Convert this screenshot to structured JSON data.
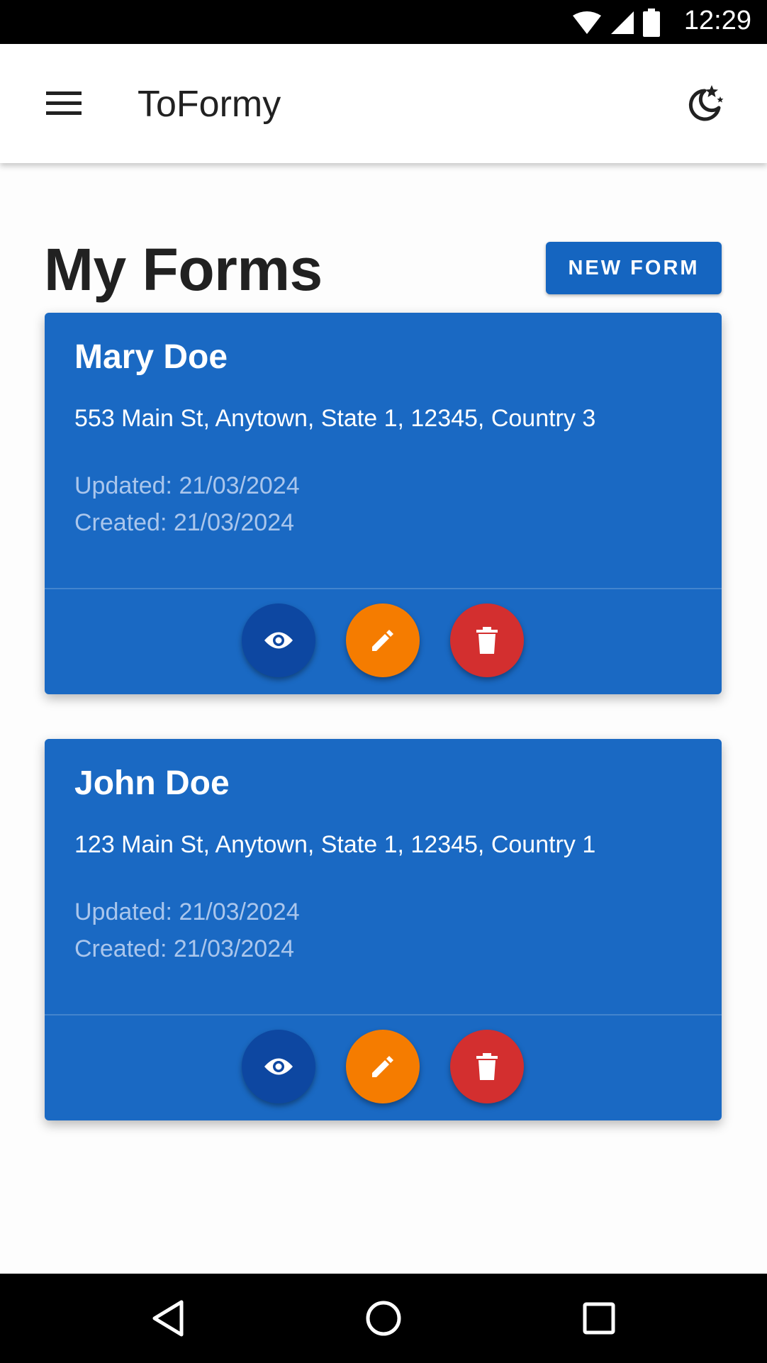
{
  "status_bar": {
    "time": "12:29",
    "icons": [
      "wifi-icon",
      "signal-icon",
      "battery-icon"
    ]
  },
  "app_bar": {
    "title": "ToFormy",
    "menu_icon": "menu-icon",
    "theme_icon": "dark-mode-icon"
  },
  "page": {
    "title": "My Forms",
    "new_form_label": "NEW FORM"
  },
  "forms": [
    {
      "name": "Mary Doe",
      "address": "553 Main St, Anytown, State 1, 12345, Country 3",
      "updated": "Updated: 21/03/2024",
      "created": "Created: 21/03/2024"
    },
    {
      "name": "John Doe",
      "address": "123 Main St, Anytown, State 1, 12345, Country 1",
      "updated": "Updated: 21/03/2024",
      "created": "Created: 21/03/2024"
    }
  ],
  "card_actions": [
    "view-icon",
    "edit-icon",
    "delete-icon"
  ],
  "nav_bar": [
    "back-icon",
    "home-icon",
    "recents-icon"
  ],
  "colors": {
    "primary": "#1565c0",
    "card": "#1a69c3",
    "view": "#0d47a1",
    "edit": "#f57c00",
    "delete": "#d32f2f"
  }
}
